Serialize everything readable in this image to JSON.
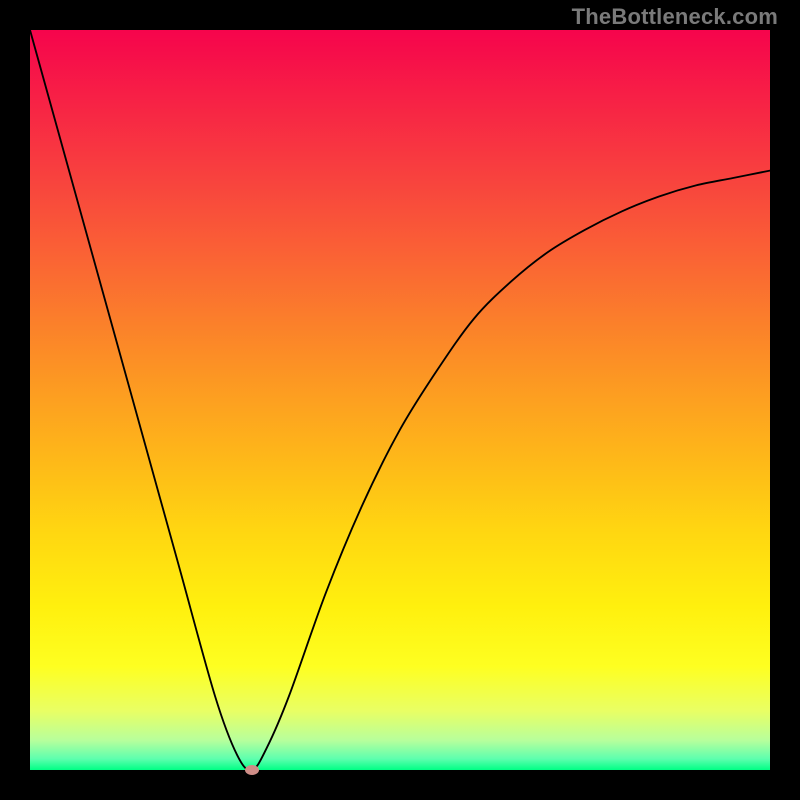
{
  "attribution": "TheBottleneck.com",
  "chart_data": {
    "type": "line",
    "title": "",
    "xlabel": "",
    "ylabel": "",
    "xlim": [
      0,
      100
    ],
    "ylim": [
      0,
      100
    ],
    "grid": false,
    "legend": false,
    "series": [
      {
        "name": "bottleneck-curve",
        "x": [
          0,
          5,
          10,
          15,
          20,
          25,
          28,
          30,
          32,
          35,
          40,
          45,
          50,
          55,
          60,
          65,
          70,
          75,
          80,
          85,
          90,
          95,
          100
        ],
        "y": [
          100,
          82,
          64,
          46,
          28,
          10,
          2,
          0,
          3,
          10,
          24,
          36,
          46,
          54,
          61,
          66,
          70,
          73,
          75.5,
          77.5,
          79,
          80,
          81
        ]
      }
    ],
    "marker": {
      "x": 30,
      "y": 0
    },
    "gradient_stops": [
      {
        "offset": 0.0,
        "color": "#f6044c"
      },
      {
        "offset": 0.1,
        "color": "#f72345"
      },
      {
        "offset": 0.2,
        "color": "#f8423e"
      },
      {
        "offset": 0.3,
        "color": "#fa6135"
      },
      {
        "offset": 0.4,
        "color": "#fb812a"
      },
      {
        "offset": 0.5,
        "color": "#fda020"
      },
      {
        "offset": 0.6,
        "color": "#febe17"
      },
      {
        "offset": 0.68,
        "color": "#ffd711"
      },
      {
        "offset": 0.78,
        "color": "#fff00e"
      },
      {
        "offset": 0.86,
        "color": "#feff21"
      },
      {
        "offset": 0.92,
        "color": "#e9ff64"
      },
      {
        "offset": 0.96,
        "color": "#b7ff9c"
      },
      {
        "offset": 0.985,
        "color": "#5dffae"
      },
      {
        "offset": 1.0,
        "color": "#00ff85"
      }
    ]
  }
}
